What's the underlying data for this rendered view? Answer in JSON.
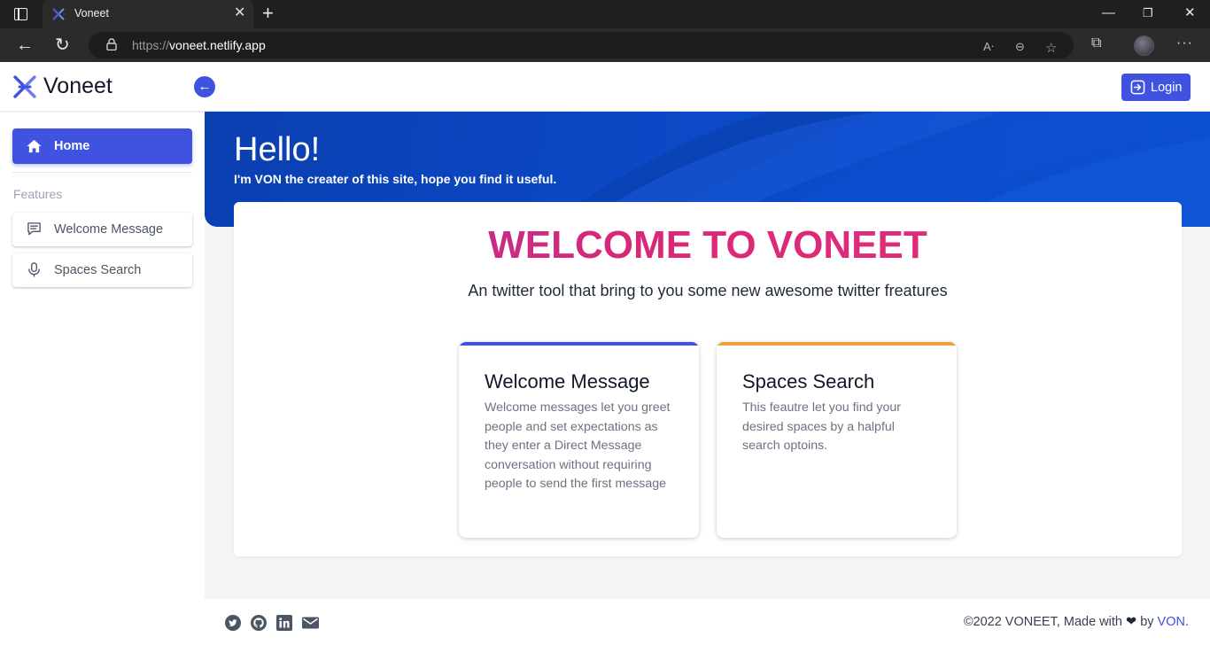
{
  "browser": {
    "tab_title": "Voneet",
    "url_scheme": "https://",
    "url_host": "voneet.netlify.app",
    "icons": [
      "sidebar-icon",
      "close-icon",
      "new-tab-icon",
      "minimize-icon",
      "restore-icon",
      "close-window-icon",
      "back-icon",
      "refresh-icon",
      "lock-icon",
      "read-aloud-icon",
      "zoom-icon",
      "favorites-icon",
      "extensions-icon",
      "profile-avatar",
      "more-icon"
    ]
  },
  "header": {
    "brand": "Voneet",
    "login_label": "Login"
  },
  "sidebar": {
    "home_label": "Home",
    "section_label": "Features",
    "items": [
      {
        "label": "Welcome Message",
        "icon": "message-icon"
      },
      {
        "label": "Spaces Search",
        "icon": "microphone-icon"
      }
    ]
  },
  "hero": {
    "title": "Hello!",
    "subtitle": "I'm VON the creater of this site, hope you find it useful."
  },
  "main": {
    "title": "WELCOME TO VONEET",
    "tagline": "An twitter tool that bring to you some new awesome twitter freatures",
    "cards": [
      {
        "title": "Welcome Message",
        "description": "Welcome messages let you greet people and set expectations as they enter a Direct Message conversation without requiring people to send the first message",
        "accent": "#4052e0"
      },
      {
        "title": "Spaces Search",
        "description": "This feautre let you find your desired spaces by a halpful search optoins.",
        "accent": "#f5a13b"
      }
    ]
  },
  "footer": {
    "copyright": "©2022 VONEET, Made with",
    "by": "by",
    "author": "VON",
    "period": ".",
    "social_icons": [
      "twitter-icon",
      "github-icon",
      "linkedin-icon",
      "email-icon"
    ]
  },
  "colors": {
    "primary": "#4052e0",
    "hero": "#0b48c4",
    "welcome_gradient": "#db2777",
    "card2_accent": "#f5a13b"
  }
}
